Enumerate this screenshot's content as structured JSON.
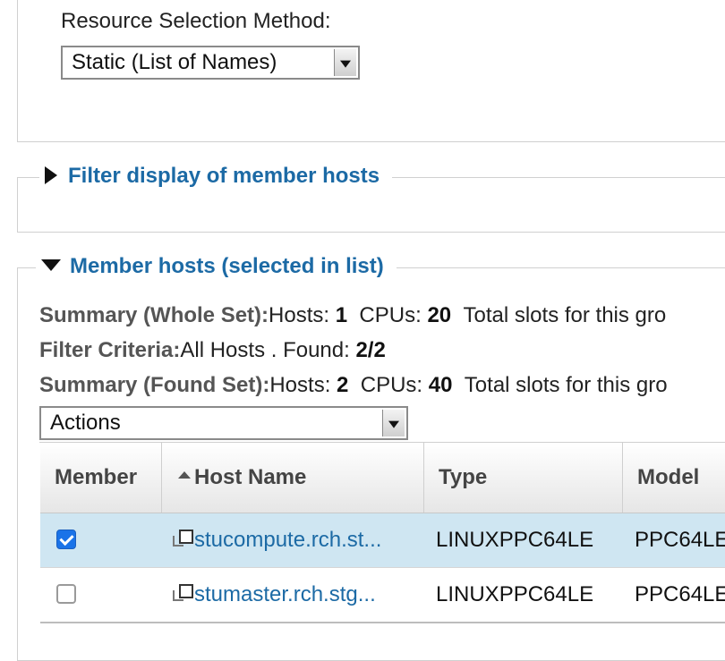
{
  "resource": {
    "label": "Resource Selection Method:",
    "selected": "Static (List of Names)"
  },
  "filter_section": {
    "title": "Filter display of member hosts"
  },
  "members_section": {
    "title": "Member hosts (selected in list)",
    "summary_whole": {
      "label": "Summary (Whole Set):",
      "hosts_label": "Hosts: ",
      "hosts": "1",
      "cpus_label": "CPUs: ",
      "cpus": "20",
      "slots_text": "Total slots for this gro"
    },
    "filter_criteria": {
      "label": "Filter Criteria:",
      "text": "All Hosts . Found: ",
      "found": "2/2"
    },
    "summary_found": {
      "label": "Summary (Found Set):",
      "hosts_label": "Hosts: ",
      "hosts": "2",
      "cpus_label": "CPUs: ",
      "cpus": "40",
      "slots_text": "Total slots for this gro"
    },
    "actions": {
      "selected": "Actions"
    }
  },
  "table": {
    "headers": {
      "member": "Member",
      "host_name": "Host Name",
      "type": "Type",
      "model": "Model"
    },
    "rows": [
      {
        "checked": true,
        "host": "stucompute.rch.st...",
        "type": "LINUXPPC64LE",
        "model": "PPC64LE"
      },
      {
        "checked": false,
        "host": "stumaster.rch.stg...",
        "type": "LINUXPPC64LE",
        "model": "PPC64LE"
      }
    ]
  },
  "icons": [
    "chevron-right-icon",
    "chevron-down-icon",
    "sort-ascending-icon",
    "checkbox-checked-icon",
    "checkbox-unchecked-icon",
    "open-in-new-window-icon",
    "dropdown-arrow-icon"
  ],
  "colors": {
    "link": "#1c6aa5",
    "selected_row": "#cfe6f2",
    "checkbox": "#1a73e8"
  }
}
